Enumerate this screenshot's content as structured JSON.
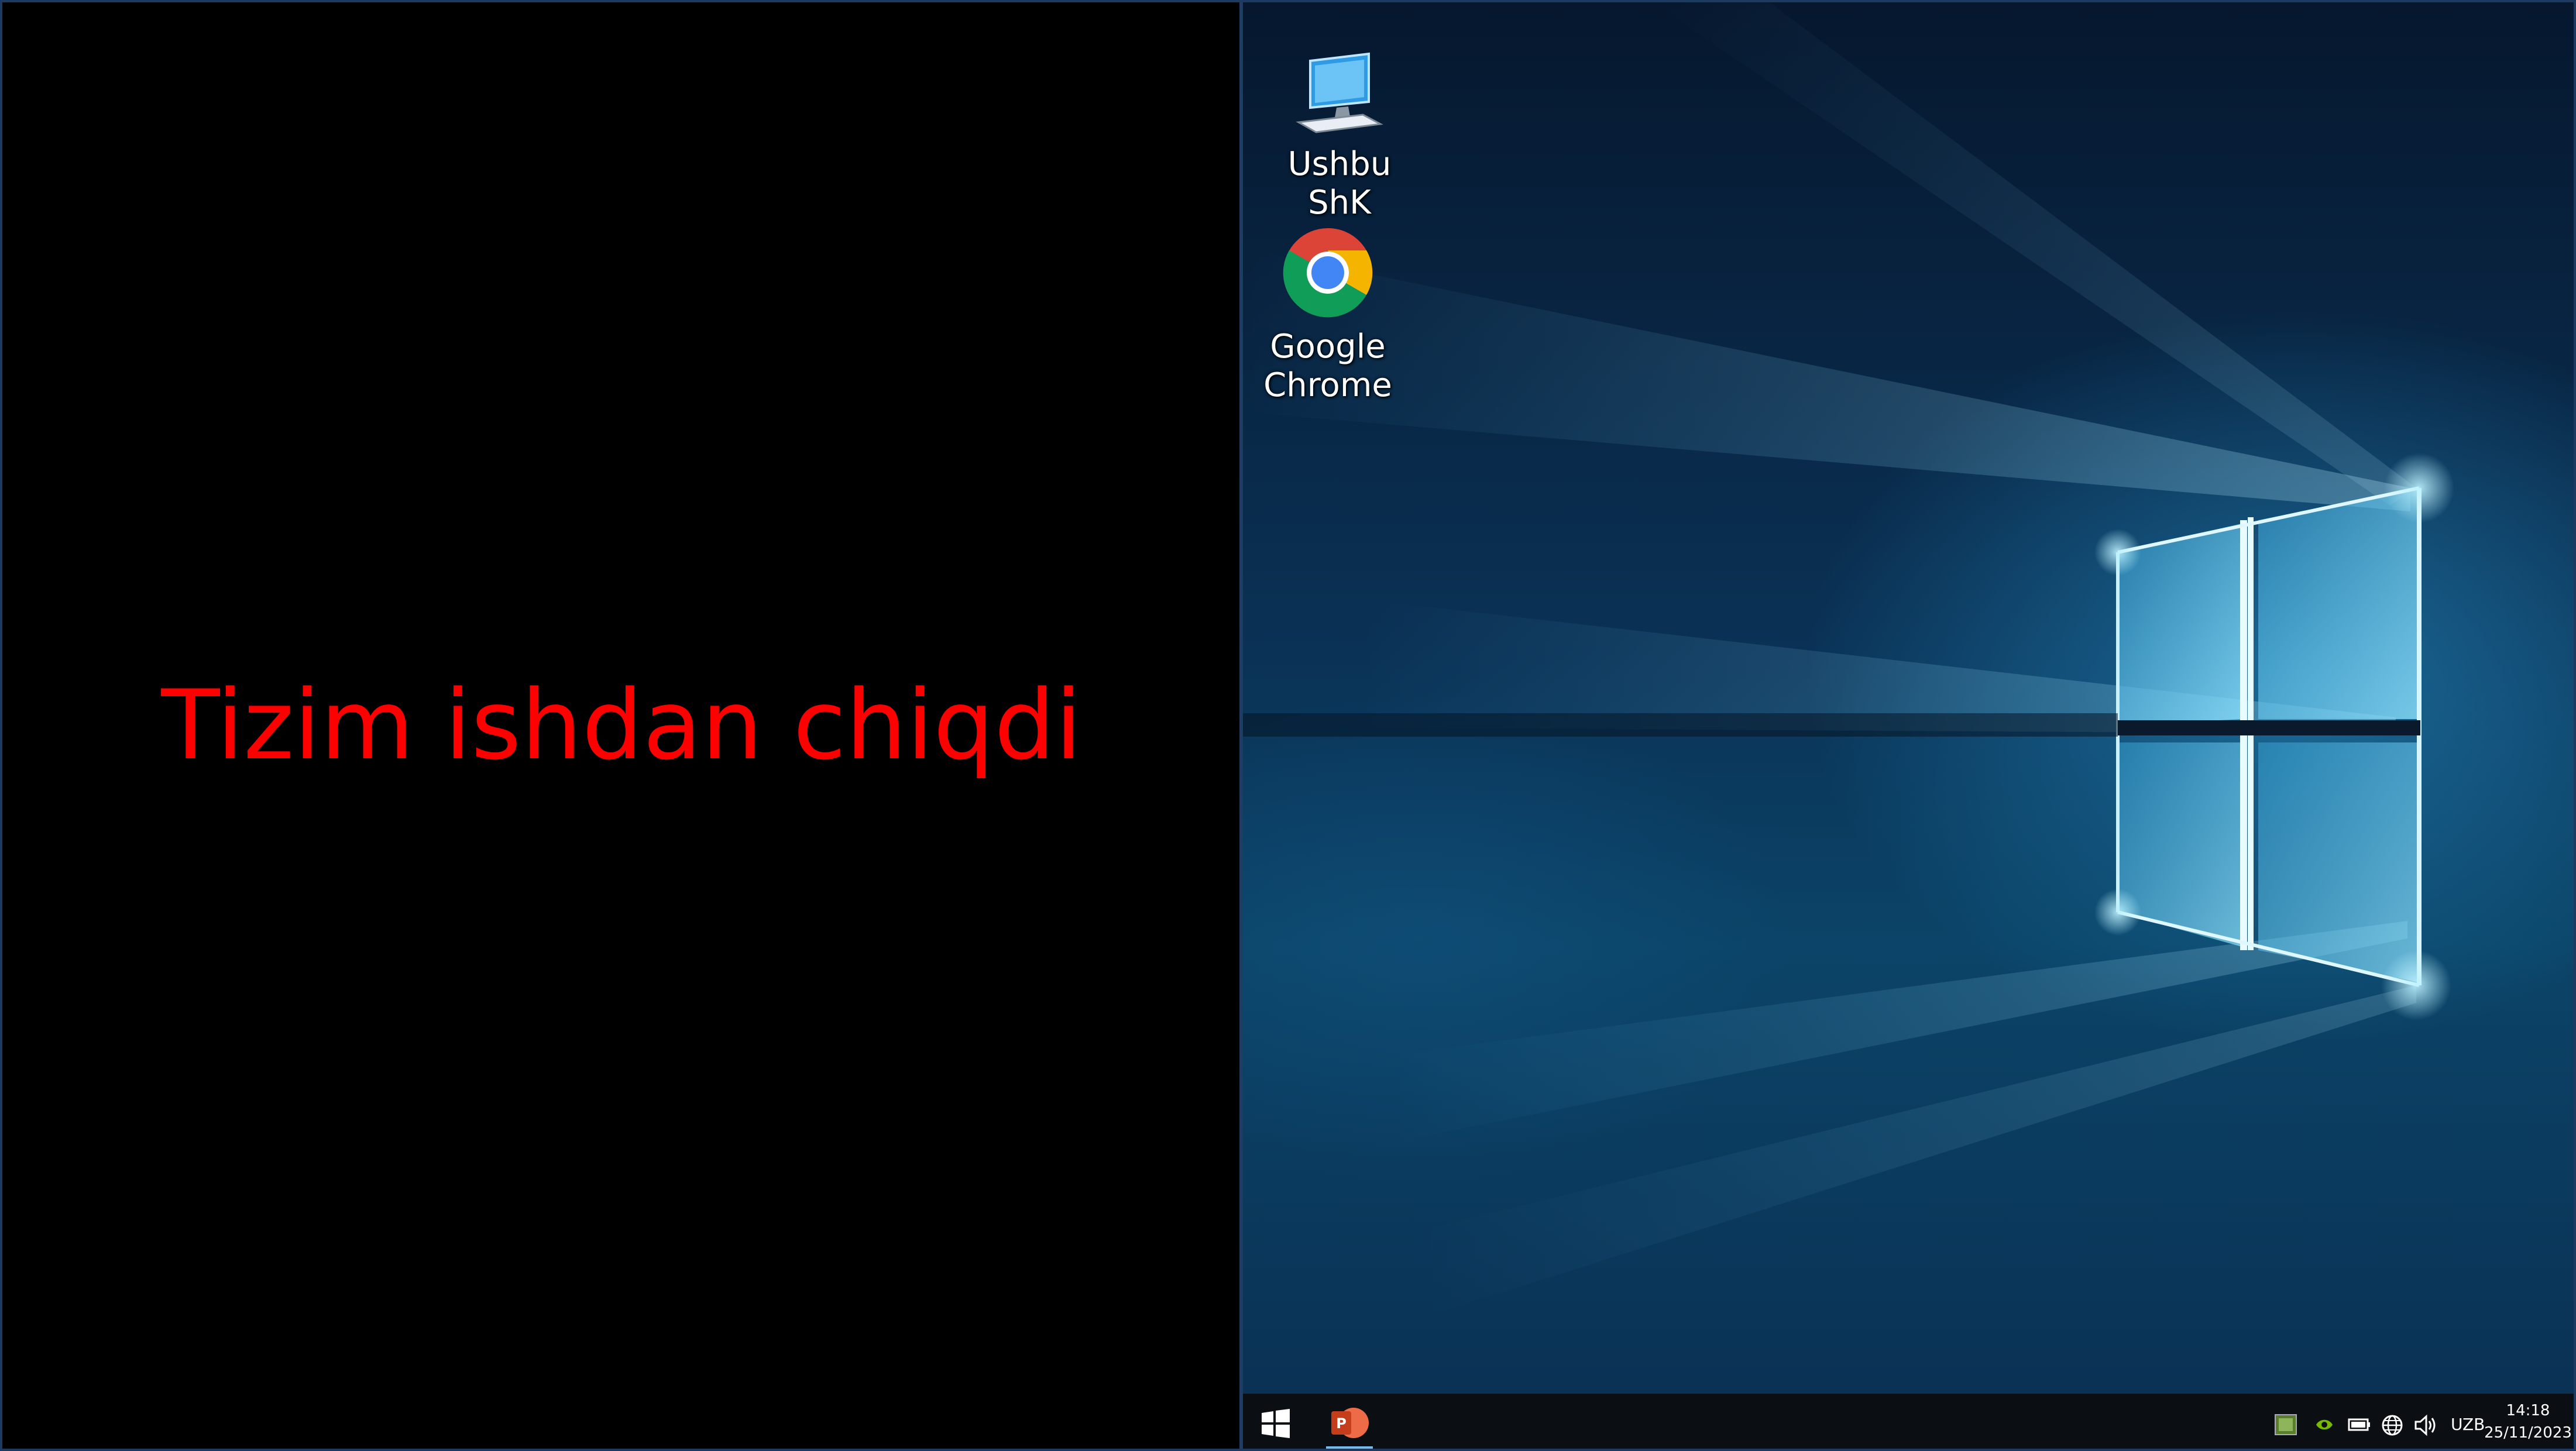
{
  "left_panel": {
    "message": "Tizim ishdan chiqdi",
    "message_color": "#ff0000",
    "background": "#000000"
  },
  "desktop": {
    "icons": [
      {
        "label": "Ushbu ShK",
        "icon": "this-pc-icon"
      },
      {
        "label": "Google Chrome",
        "icon": "chrome-icon"
      }
    ]
  },
  "taskbar": {
    "start_icon": "windows-logo-icon",
    "pinned_app": "powerpoint-icon",
    "tray": {
      "icons": [
        "app-tray-icon",
        "nvidia-icon",
        "battery-icon",
        "network-globe-icon",
        "volume-icon"
      ],
      "language": "UZB",
      "time": "14:18",
      "date": "25/11/2023"
    }
  },
  "colors": {
    "taskbar_bg": "#0b0f14",
    "active_indicator": "#76b9ed",
    "frame_border": "#1d3a60"
  }
}
